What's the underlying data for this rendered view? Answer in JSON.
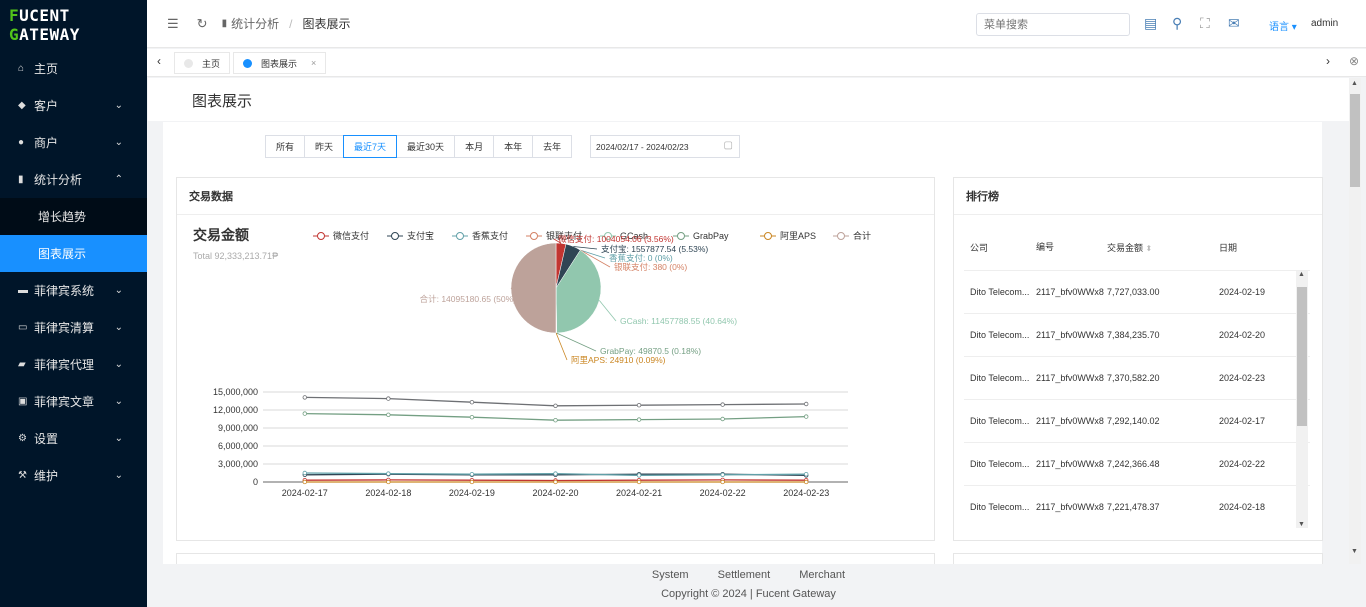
{
  "brand": {
    "logo_text": "FUCENT GATEWAY"
  },
  "sidebar": {
    "items": [
      {
        "label": "主页"
      },
      {
        "label": "客户"
      },
      {
        "label": "商户"
      },
      {
        "label": "统计分析"
      },
      {
        "label": "增长趋势"
      },
      {
        "label": "图表展示"
      },
      {
        "label": "菲律宾系统"
      },
      {
        "label": "菲律宾清算"
      },
      {
        "label": "菲律宾代理"
      },
      {
        "label": "菲律宾文章"
      },
      {
        "label": "设置"
      },
      {
        "label": "维护"
      }
    ]
  },
  "topbar": {
    "breadcrumb_parent": "统计分析",
    "breadcrumb_sep": "/",
    "breadcrumb_current": "图表展示",
    "search_placeholder": "菜单搜索",
    "lang": "语言",
    "user": "admin"
  },
  "tabs": [
    {
      "label": "主页"
    },
    {
      "label": "图表展示"
    }
  ],
  "page": {
    "title": "图表展示"
  },
  "filter": {
    "buttons": [
      "所有",
      "昨天",
      "最近7天",
      "最近30天",
      "本月",
      "本年",
      "去年"
    ],
    "active": "最近7天",
    "date_range": "2024/02/17 - 2024/02/23"
  },
  "trade_panel": {
    "title": "交易数据"
  },
  "rank_panel": {
    "title": "排行榜",
    "headers": [
      "公司",
      "编号",
      "交易金额",
      "日期"
    ],
    "rows": [
      {
        "company": "Dito Telecom...",
        "id": "2117_bfv0WWx8",
        "amount": "7,727,033.00",
        "date": "2024-02-19"
      },
      {
        "company": "Dito Telecom...",
        "id": "2117_bfv0WWx8",
        "amount": "7,384,235.70",
        "date": "2024-02-20"
      },
      {
        "company": "Dito Telecom...",
        "id": "2117_bfv0WWx8",
        "amount": "7,370,582.20",
        "date": "2024-02-23"
      },
      {
        "company": "Dito Telecom...",
        "id": "2117_bfv0WWx8",
        "amount": "7,292,140.02",
        "date": "2024-02-17"
      },
      {
        "company": "Dito Telecom...",
        "id": "2117_bfv0WWx8",
        "amount": "7,242,366.48",
        "date": "2024-02-22"
      },
      {
        "company": "Dito Telecom...",
        "id": "2117_bfv0WWx8",
        "amount": "7,221,478.37",
        "date": "2024-02-18"
      }
    ]
  },
  "footer": {
    "links": [
      "System",
      "Settlement",
      "Merchant"
    ],
    "copyright": "Copyright © 2024 | Fucent Gateway"
  },
  "colors": {
    "sidebar_bg": "#001529",
    "accent": "#1890ff",
    "brand_green": "#52c41a"
  },
  "chart_data": [
    {
      "type": "pie",
      "title": "交易金额",
      "subtitle": "Total 92,333,213.71₱",
      "legend": [
        "微信支付",
        "支付宝",
        "香蕉支付",
        "银联支付",
        "GCash",
        "GrabPay",
        "阿里APS",
        "合计"
      ],
      "slices": [
        {
          "name": "微信支付",
          "value": 1004054.06,
          "percent": 3.56,
          "label": "微信支付: 1004054.06 (3.56%)",
          "color": "#c23531"
        },
        {
          "name": "支付宝",
          "value": 1557877.54,
          "percent": 5.53,
          "label": "支付宝: 1557877.54 (5.53%)",
          "color": "#2f4554"
        },
        {
          "name": "香蕉支付",
          "value": 0,
          "percent": 0,
          "label": "香蕉支付: 0 (0%)",
          "color": "#61a0a8"
        },
        {
          "name": "银联支付",
          "value": 380,
          "percent": 0,
          "label": "银联支付: 380 (0%)",
          "color": "#d48265"
        },
        {
          "name": "GCash",
          "value": 11457788.55,
          "percent": 40.64,
          "label": "GCash: 11457788.55 (40.64%)",
          "color": "#91c7ae"
        },
        {
          "name": "GrabPay",
          "value": 49870.5,
          "percent": 0.18,
          "label": "GrabPay: 49870.5 (0.18%)",
          "color": "#749f83"
        },
        {
          "name": "阿里APS",
          "value": 24910,
          "percent": 0.09,
          "label": "阿里APS: 24910 (0.09%)",
          "color": "#ca8622"
        },
        {
          "name": "合计",
          "value": 14095180.65,
          "percent": 50,
          "label": "合计: 14095180.65 (50%)",
          "color": "#bda29a"
        }
      ]
    },
    {
      "type": "line",
      "categories": [
        "2024-02-17",
        "2024-02-18",
        "2024-02-19",
        "2024-02-20",
        "2024-02-21",
        "2024-02-22",
        "2024-02-23"
      ],
      "yticks": [
        "0",
        "3,000,000",
        "6,000,000",
        "9,000,000",
        "12,000,000",
        "15,000,000"
      ],
      "ylim": [
        0,
        15000000
      ],
      "series": [
        {
          "name": "合计",
          "color": "#6e7074",
          "values": [
            14100000,
            13900000,
            13300000,
            12700000,
            12800000,
            12900000,
            13000000
          ]
        },
        {
          "name": "GCash",
          "color": "#749f83",
          "values": [
            11400000,
            11200000,
            10800000,
            10300000,
            10400000,
            10500000,
            10900000
          ]
        },
        {
          "name": "支付宝",
          "color": "#2f4554",
          "values": [
            1200000,
            1300000,
            1200000,
            1200000,
            1300000,
            1300000,
            1100000
          ]
        },
        {
          "name": "银联支付",
          "color": "#61a0a8",
          "values": [
            1500000,
            1400000,
            1300000,
            1400000,
            1100000,
            1200000,
            1300000
          ]
        },
        {
          "name": "微信支付",
          "color": "#c23531",
          "values": [
            300000,
            350000,
            300000,
            250000,
            300000,
            350000,
            300000
          ]
        },
        {
          "name": "阿里APS",
          "color": "#ca8622",
          "values": [
            5000,
            6000,
            5000,
            4000,
            5000,
            5000,
            4000
          ]
        }
      ]
    }
  ]
}
